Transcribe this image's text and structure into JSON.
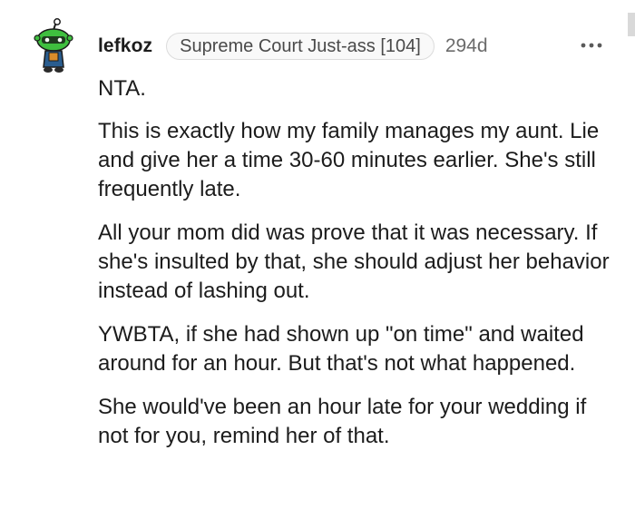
{
  "comment": {
    "author": "lefkoz",
    "flair": "Supreme Court Just-ass [104]",
    "age": "294d",
    "paragraphs": [
      "NTA.",
      "This is exactly how my family manages my aunt. Lie and give her a time 30-60 minutes earlier. She's still frequently late.",
      "All your mom did was prove that it was necessary. If she's insulted by that, she should adjust her behavior instead of lashing out.",
      "YWBTA, if she had shown up \"on time\" and waited around for an hour. But that's not what happened.",
      "She would've been an hour late for your wedding if not for you, remind her of that."
    ]
  },
  "icons": {
    "avatar": "snoo-avatar",
    "more": "more-options-icon"
  },
  "colors": {
    "text": "#1c1c1c",
    "muted": "#6b6b6b",
    "flair_border": "#dcdcdc",
    "avatar_green": "#3fbf3f",
    "avatar_body": "#2a5d8f"
  }
}
